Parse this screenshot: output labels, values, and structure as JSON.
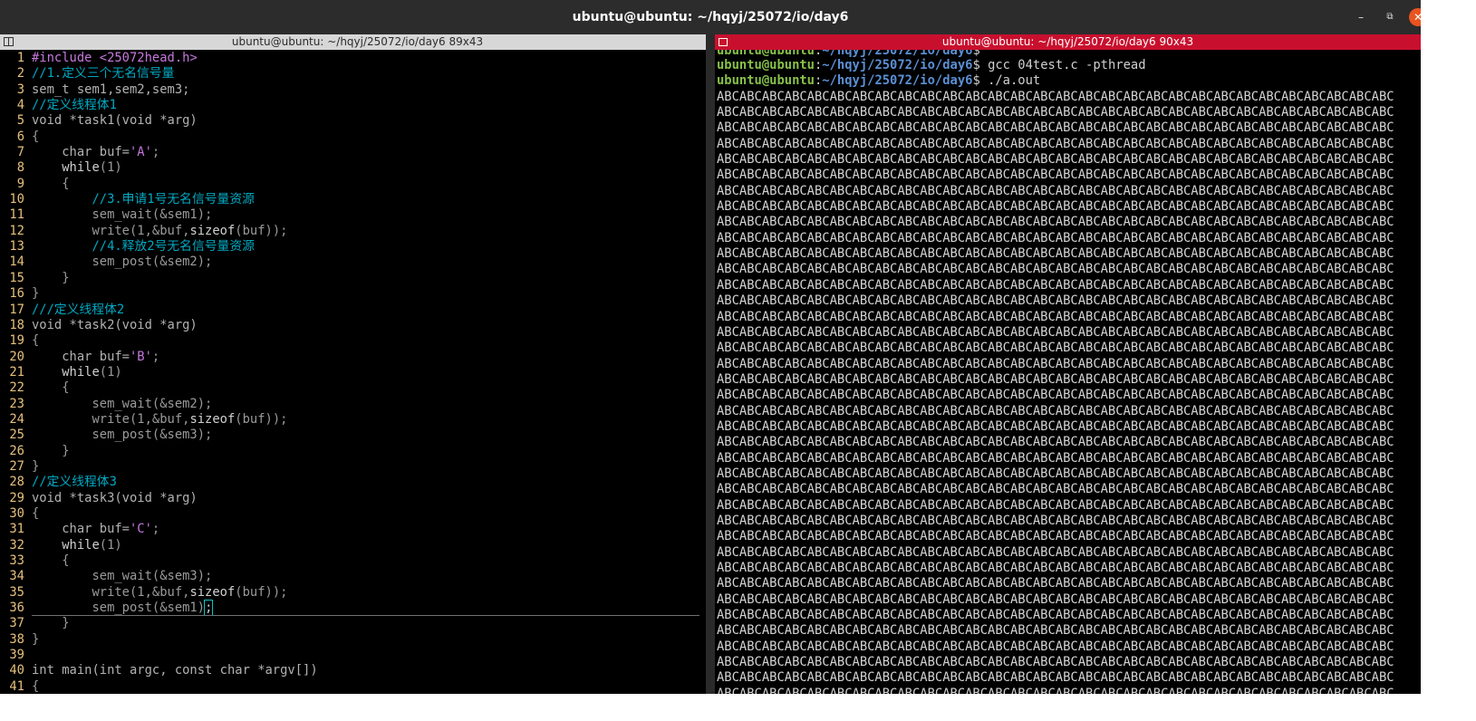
{
  "window": {
    "title": "ubuntu@ubuntu: ~/hqyj/25072/io/day6",
    "minimize_icon": "minimize-icon",
    "maximize_icon": "restore-icon",
    "close_icon": "close-icon",
    "minimize_glyph": "–",
    "maximize_glyph": "⧉",
    "close_glyph": "✕"
  },
  "left_pane": {
    "header": "ubuntu@ubuntu: ~/hqyj/25072/io/day6 89x43",
    "code_lines": [
      {
        "n": "1",
        "parts": [
          [
            "inc",
            "#include "
          ],
          [
            "str",
            "<25072head.h>"
          ]
        ]
      },
      {
        "n": "2",
        "parts": [
          [
            "cm",
            "//1.定义三个无名信号量"
          ]
        ]
      },
      {
        "n": "3",
        "parts": [
          [
            "ty",
            "sem_t sem1,sem2,sem3;"
          ]
        ]
      },
      {
        "n": "4",
        "parts": [
          [
            "cm",
            "//定义线程体1"
          ]
        ]
      },
      {
        "n": "5",
        "parts": [
          [
            "ty",
            "void *task1(void *arg)"
          ]
        ]
      },
      {
        "n": "6",
        "parts": [
          [
            "fn",
            "{"
          ]
        ]
      },
      {
        "n": "7",
        "parts": [
          [
            "ty",
            "    char buf="
          ],
          [
            "str",
            "'A'"
          ],
          [
            "fn",
            ";"
          ]
        ]
      },
      {
        "n": "8",
        "parts": [
          [
            "kw",
            "    while"
          ],
          [
            "fn",
            "(1)"
          ]
        ]
      },
      {
        "n": "9",
        "parts": [
          [
            "fn",
            "    {"
          ]
        ]
      },
      {
        "n": "10",
        "parts": [
          [
            "cm",
            "        //3.申请1号无名信号量资源"
          ]
        ]
      },
      {
        "n": "11",
        "parts": [
          [
            "fn",
            "        sem_wait(&sem1);"
          ]
        ]
      },
      {
        "n": "12",
        "parts": [
          [
            "fn",
            "        write(1,&buf,"
          ],
          [
            "kw",
            "sizeof"
          ],
          [
            "fn",
            "(buf));"
          ]
        ]
      },
      {
        "n": "13",
        "parts": [
          [
            "cm",
            "        //4.释放2号无名信号量资源"
          ]
        ]
      },
      {
        "n": "14",
        "parts": [
          [
            "fn",
            "        sem_post(&sem2);"
          ]
        ]
      },
      {
        "n": "15",
        "parts": [
          [
            "fn",
            "    }"
          ]
        ]
      },
      {
        "n": "16",
        "parts": [
          [
            "fn",
            "}"
          ]
        ]
      },
      {
        "n": "17",
        "parts": [
          [
            "cm",
            "///定义线程体2"
          ]
        ]
      },
      {
        "n": "18",
        "parts": [
          [
            "ty",
            "void *task2(void *arg)"
          ]
        ]
      },
      {
        "n": "19",
        "parts": [
          [
            "fn",
            "{"
          ]
        ]
      },
      {
        "n": "20",
        "parts": [
          [
            "ty",
            "    char buf="
          ],
          [
            "str",
            "'B'"
          ],
          [
            "fn",
            ";"
          ]
        ]
      },
      {
        "n": "21",
        "parts": [
          [
            "kw",
            "    while"
          ],
          [
            "fn",
            "(1)"
          ]
        ]
      },
      {
        "n": "22",
        "parts": [
          [
            "fn",
            "    {"
          ]
        ]
      },
      {
        "n": "23",
        "parts": [
          [
            "fn",
            "        sem_wait(&sem2);"
          ]
        ]
      },
      {
        "n": "24",
        "parts": [
          [
            "fn",
            "        write(1,&buf,"
          ],
          [
            "kw",
            "sizeof"
          ],
          [
            "fn",
            "(buf));"
          ]
        ]
      },
      {
        "n": "25",
        "parts": [
          [
            "fn",
            "        sem_post(&sem3);"
          ]
        ]
      },
      {
        "n": "26",
        "parts": [
          [
            "fn",
            "    }"
          ]
        ]
      },
      {
        "n": "27",
        "parts": [
          [
            "fn",
            "}"
          ]
        ]
      },
      {
        "n": "28",
        "parts": [
          [
            "cm",
            "//定义线程体3"
          ]
        ]
      },
      {
        "n": "29",
        "parts": [
          [
            "ty",
            "void *task3(void *arg)"
          ]
        ]
      },
      {
        "n": "30",
        "parts": [
          [
            "fn",
            "{"
          ]
        ]
      },
      {
        "n": "31",
        "parts": [
          [
            "ty",
            "    char buf="
          ],
          [
            "str",
            "'C'"
          ],
          [
            "fn",
            ";"
          ]
        ]
      },
      {
        "n": "32",
        "parts": [
          [
            "kw",
            "    while"
          ],
          [
            "fn",
            "(1)"
          ]
        ]
      },
      {
        "n": "33",
        "parts": [
          [
            "fn",
            "    {"
          ]
        ]
      },
      {
        "n": "34",
        "parts": [
          [
            "fn",
            "        sem_wait(&sem3);"
          ]
        ]
      },
      {
        "n": "35",
        "parts": [
          [
            "fn",
            "        write(1,&buf,"
          ],
          [
            "kw",
            "sizeof"
          ],
          [
            "fn",
            "(buf));"
          ]
        ]
      },
      {
        "n": "36",
        "parts": [
          [
            "fn",
            "        sem_post(&sem1)"
          ],
          [
            "cursor",
            ";"
          ]
        ],
        "current": true
      },
      {
        "n": "37",
        "parts": [
          [
            "fn",
            "    }"
          ]
        ]
      },
      {
        "n": "38",
        "parts": [
          [
            "fn",
            "}"
          ]
        ]
      },
      {
        "n": "39",
        "parts": []
      },
      {
        "n": "40",
        "parts": [
          [
            "ty",
            "int main(int argc, const char *argv[])"
          ]
        ]
      },
      {
        "n": "41",
        "parts": [
          [
            "fn",
            "{"
          ]
        ]
      }
    ]
  },
  "right_pane": {
    "header": "ubuntu@ubuntu: ~/hqyj/25072/io/day6 90x43",
    "prompt_user": "ubuntu@ubuntu",
    "prompt_sep": ":",
    "prompt_path": "~/hqyj/25072/io/day6",
    "prompt_end": "$ ",
    "commands": [
      "",
      "gcc 04test.c -pthread",
      "./a.out"
    ],
    "output_line": "ABCABCABCABCABCABCABCABCABCABCABCABCABCABCABCABCABCABCABCABCABCABCABCABCABCABCABCABCABCABC",
    "output_line_count": 39
  }
}
